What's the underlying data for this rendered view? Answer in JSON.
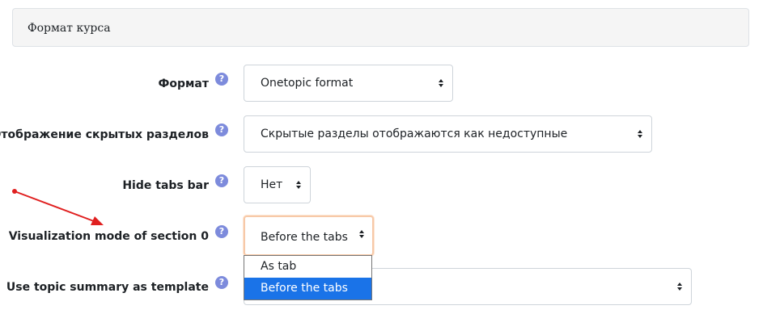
{
  "section": {
    "title": "Формат курса"
  },
  "fields": [
    {
      "label": "Формат",
      "help": "?",
      "value": "Onetopic format"
    },
    {
      "label": "Отображение скрытых разделов",
      "help": "?",
      "value": "Скрытые разделы отображаются как недоступные"
    },
    {
      "label": "Hide tabs bar",
      "help": "?",
      "value": "Нет"
    },
    {
      "label": "Visualization mode of section 0",
      "help": "?",
      "value": "Before the tabs"
    },
    {
      "label": "Use topic summary as template",
      "help": "?",
      "value": ""
    }
  ],
  "dropdown": {
    "options": [
      "As tab",
      "Before the tabs"
    ],
    "selected_index": 1
  },
  "colors": {
    "help_icon": "#7d8bdc",
    "selected_option": "#1a73e8",
    "annotation_arrow": "#e02020",
    "focus_border": "#f7c9a8"
  }
}
